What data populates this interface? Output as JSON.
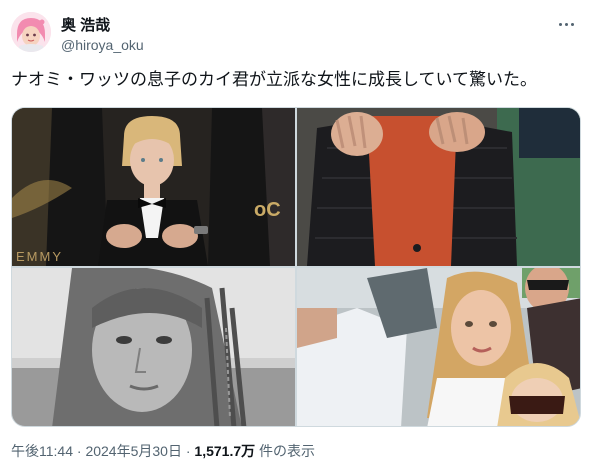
{
  "author": {
    "display_name": "奥 浩哉",
    "handle": "@hiroya_oku",
    "avatar_icon": "pink-haired-avatar-icon"
  },
  "tweet": {
    "text": "ナオミ・ワッツの息子のカイ君が立派な女性に成長していて驚いた。"
  },
  "media": {
    "photos": [
      {
        "name": "photo-boy-in-tuxedo",
        "overlay_text": "EMMY"
      },
      {
        "name": "photo-red-sweater-jacket"
      },
      {
        "name": "photo-bw-portrait"
      },
      {
        "name": "photo-group-selfie"
      }
    ]
  },
  "meta": {
    "time": "午後11:44",
    "sep1": " · ",
    "date": "2024年5月30日",
    "sep2": " · ",
    "views": "1,571.7万",
    "views_suffix": " 件の表示"
  },
  "colors": {
    "text": "#0f1419",
    "secondary": "#536471",
    "border": "#cfd9de"
  }
}
